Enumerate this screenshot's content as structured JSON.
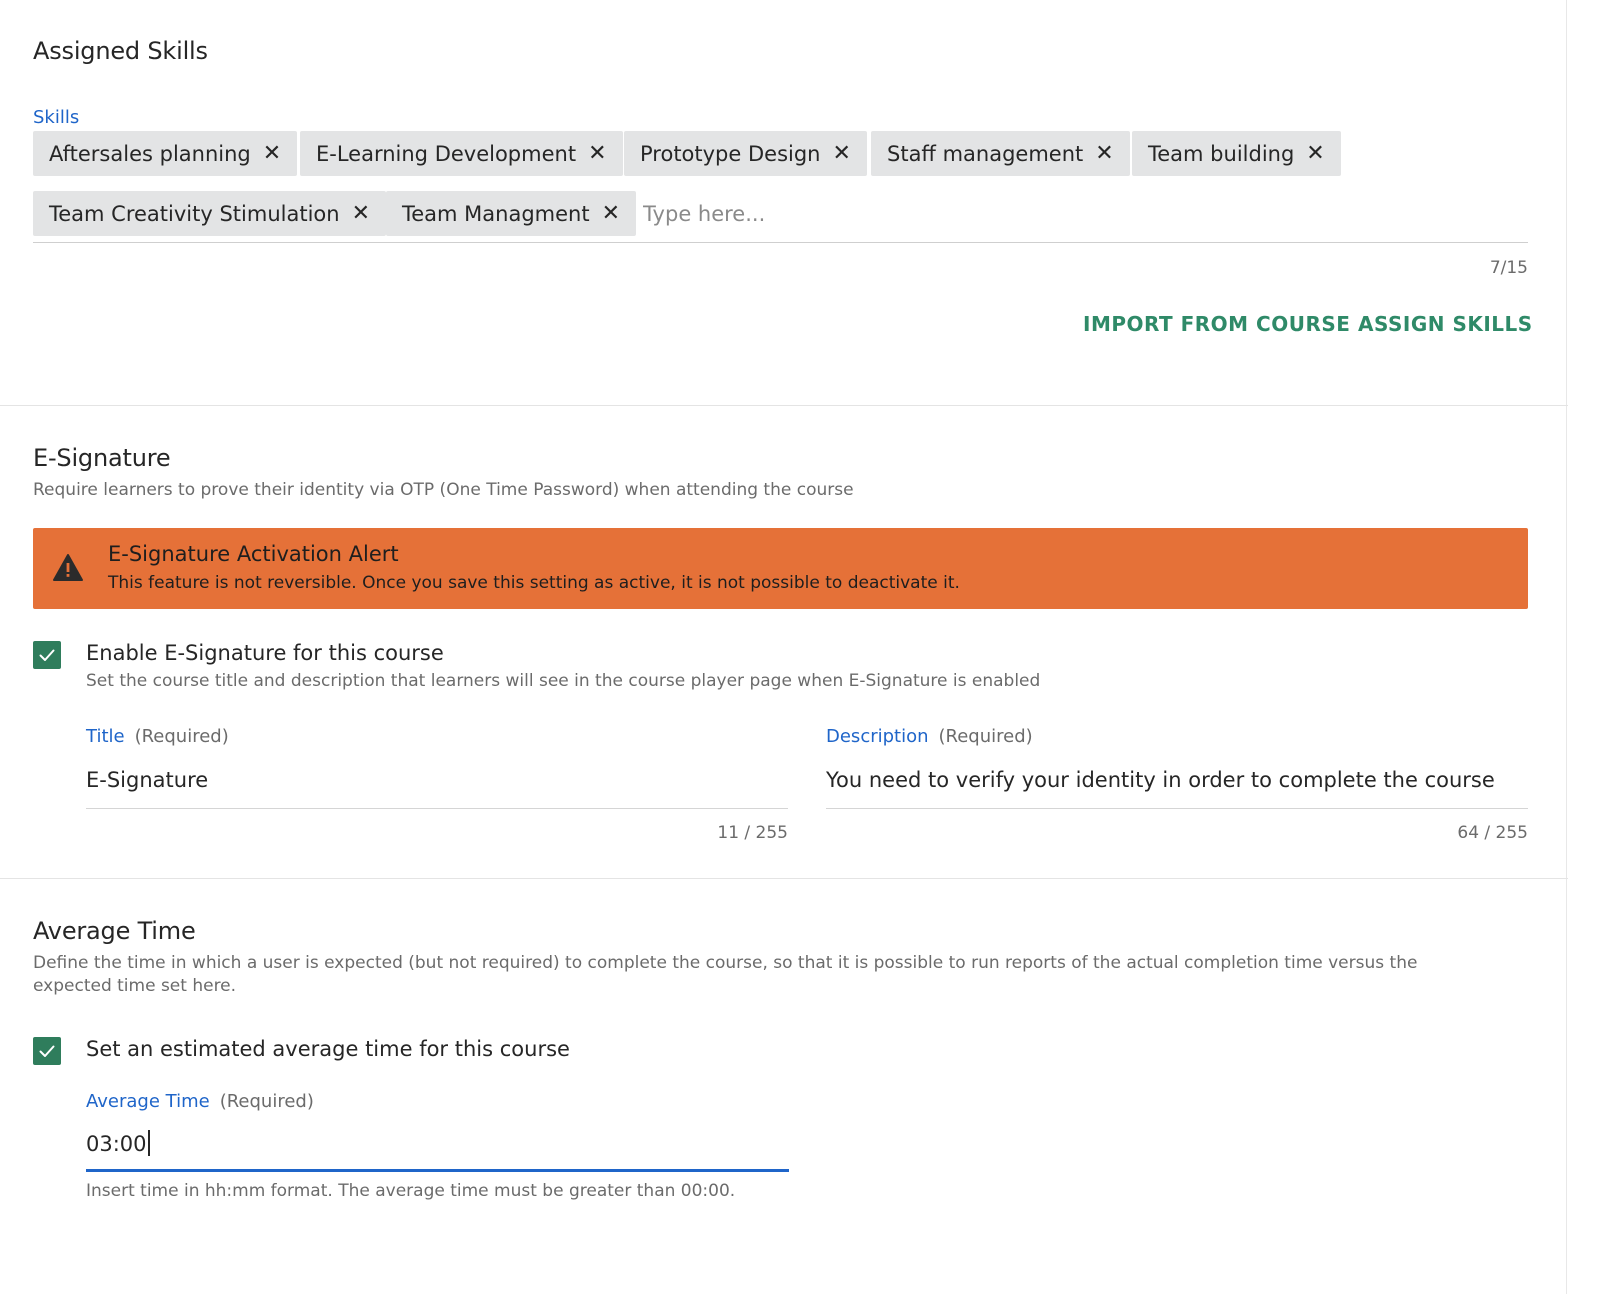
{
  "skills_section": {
    "title": "Assigned Skills",
    "field_label": "Skills",
    "chips": [
      "Aftersales planning",
      "E-Learning Development",
      "Prototype Design",
      "Staff management",
      "Team building",
      "Team Creativity Stimulation",
      "Team Managment"
    ],
    "remove_glyph": "✕",
    "input_placeholder": "Type here...",
    "counter": "7/15",
    "import_button": "IMPORT FROM COURSE",
    "assign_button": "ASSIGN SKILLS"
  },
  "esignature": {
    "title": "E-Signature",
    "subtitle": "Require learners to prove their identity via OTP (One Time Password) when attending the course",
    "alert": {
      "icon": "warning-icon",
      "title": "E-Signature Activation Alert",
      "text": "This feature is not reversible. Once you save this setting as active, it is not possible to deactivate it."
    },
    "checkbox": {
      "checked": true,
      "label": "Enable E-Signature for this course",
      "description": "Set the course title and description that learners will see in the course player page when E-Signature is enabled"
    },
    "title_field": {
      "label": "Title",
      "required": "(Required)",
      "value": "E-Signature",
      "counter": "11 / 255"
    },
    "description_field": {
      "label": "Description",
      "required": "(Required)",
      "value": "You need to verify your identity in order to complete the course",
      "counter": "64 / 255"
    }
  },
  "average_time": {
    "title": "Average Time",
    "subtitle_line1": "Define the time in which a user is expected (but not required) to complete the course, so that it is possible to run reports of the actual completion time versus the",
    "subtitle_line2": "expected time set here.",
    "checkbox": {
      "checked": true,
      "label": "Set an estimated average time for this course"
    },
    "field": {
      "label": "Average Time",
      "required": "(Required)",
      "value": "03:00",
      "hint": "Insert time in hh:mm format. The average time must be greater than 00:00."
    }
  },
  "colors": {
    "accent_blue": "#1f65c9",
    "accent_green": "#2f8a68",
    "checkbox_green": "#2f7d5c",
    "alert_orange": "#e57138",
    "chip_gray": "#e3e4e5"
  }
}
